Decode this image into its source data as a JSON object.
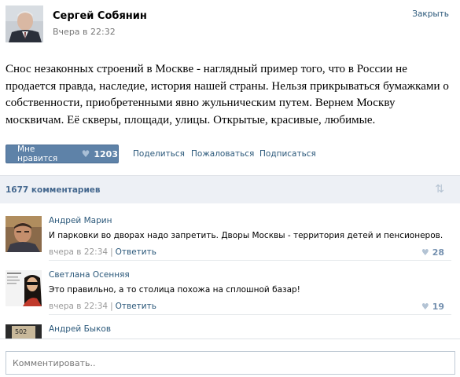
{
  "post": {
    "author": "Сергей Собянин",
    "time": "Вчера в 22:32",
    "close_label": "Закрыть",
    "text": "Снос незаконных строений в Москве - наглядный пример того, что в России не продается правда, наследие, история нашей страны. Нельзя прикрываться бумажками о собственности, приобретенными явно жульническим путем. Вернем Москву москвичам. Её скверы, площади, улицы. Открытые, красивые, любимые.",
    "like_label": "Мне нравится",
    "like_count": "1203",
    "share_label": "Поделиться",
    "report_label": "Пожаловаться",
    "subscribe_label": "Подписаться"
  },
  "comments_header": {
    "count_label": "1677 комментариев"
  },
  "comments": [
    {
      "name": "Андрей Марин",
      "text": "И парковки во дворах надо запретить. Дворы Москвы - территория детей и пенсионеров.",
      "time": "вчера в 22:34",
      "reply": "Ответить",
      "likes": "28"
    },
    {
      "name": "Светлана Осенняя",
      "text": "Это правильно, а то столица похожа на сплошной базар!",
      "time": "вчера в 22:34",
      "reply": "Ответить",
      "likes": "19"
    },
    {
      "name": "Андрей Быков",
      "avatar_text": "502"
    }
  ],
  "input": {
    "placeholder": "Комментировать.."
  },
  "colors": {
    "link": "#2b587a",
    "like_button": "#5e82a8",
    "comments_bar": "#edf0f5"
  }
}
